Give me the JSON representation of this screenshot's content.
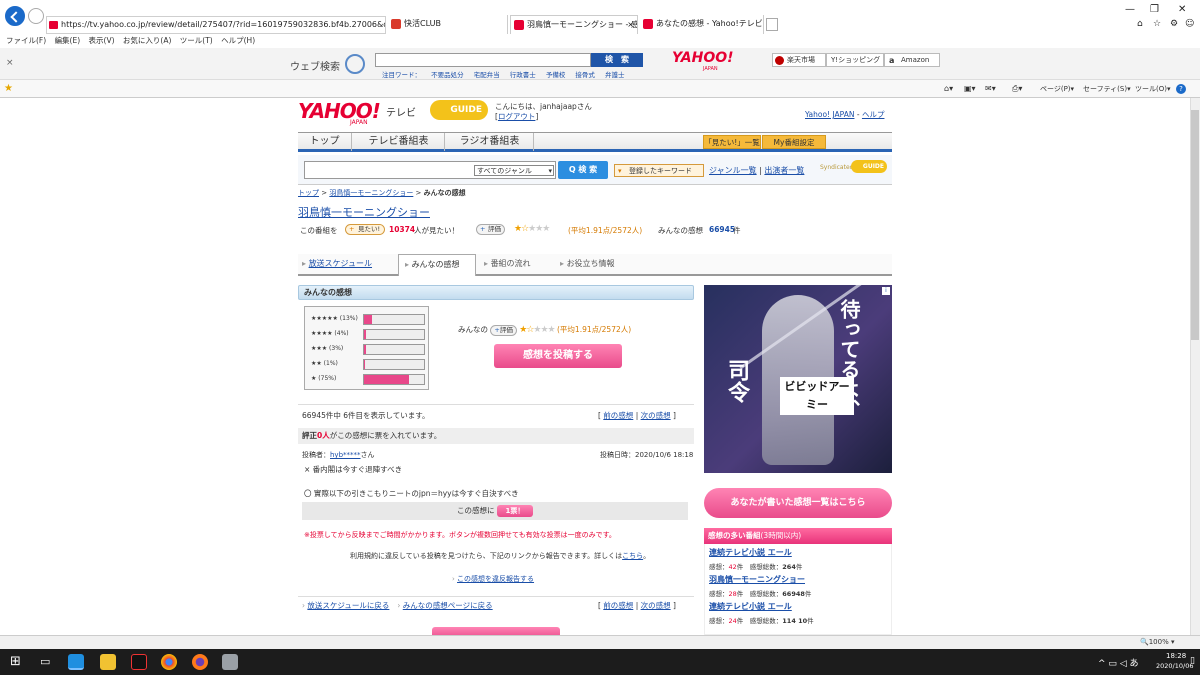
{
  "browser": {
    "url": "https://tv.yahoo.co.jp/review/detail/275407/?rid=16019759032836.bf4b.27006&o=1&",
    "tabs": [
      {
        "title": "快活CLUB",
        "color": "#d93a2b"
      },
      {
        "title": "羽鳥慎一モーニングショー - 感...",
        "color": "#e60033"
      },
      {
        "title": "あなたの感想 - Yahoo!テレビG...",
        "color": "#e60033"
      }
    ],
    "menu": [
      "ファイル(F)",
      "編集(E)",
      "表示(V)",
      "お気に入り(A)",
      "ツール(T)",
      "ヘルプ(H)"
    ],
    "search_label": "ウェブ検索",
    "search_button": "検　索",
    "search_links": [
      "注目ワード：",
      "不要品処分",
      "宅配弁当",
      "行政書士",
      "予備校",
      "接骨式",
      "弁護士"
    ],
    "yahoo_logo": "YAHOO!",
    "yahoo_sub": "JAPAN",
    "shortcuts": [
      "楽天市場",
      "Y!ショッピング",
      "Amazon"
    ],
    "cmd": [
      "ページ(P)",
      "セーフティ(S)",
      "ツール(O)"
    ],
    "zoom": "100%",
    "clock_time": "18:28",
    "clock_date": "2020/10/06"
  },
  "site": {
    "logo": "YAHOO!",
    "logo_sub": "JAPAN",
    "logo_tv": "テレビ",
    "gguide": "GUIDE",
    "greeting": "こんにちは、",
    "username": "janhajaap",
    "san": "さん",
    "logout": "ログアウト",
    "yahoo_japan_link": "Yahoo! JAPAN",
    "help_link": "ヘルプ",
    "nav_tabs": [
      "トップ",
      "テレビ番組表",
      "ラジオ番組表"
    ],
    "mitai_btn": "「見たい!」一覧",
    "my_btn": "My番組設定",
    "genre": "すべてのジャンル",
    "search_btn": "Q 検 索",
    "kw_btn": "登録したキーワード",
    "genre_list": "ジャンル一覧",
    "performer_list": "出演者一覧",
    "sync": "Syndicated"
  },
  "breadcrumb": [
    "トップ",
    "羽鳥慎一モーニングショー",
    "みんなの感想"
  ],
  "program": {
    "title": "羽鳥慎一モーニングショー",
    "mitai_pre": "この番組を",
    "mitai_btn": "見たい!",
    "mitai_count": "10374",
    "mitai_post": "人が見たい！",
    "rate_btn": "評価",
    "avg": "(平均1.91点/2572人)",
    "review_label": "みんなの感想",
    "review_count": "66945",
    "review_unit": "件"
  },
  "subtabs": [
    "放送スケジュール",
    "みんなの感想",
    "番組の流れ",
    "お役立ち情報"
  ],
  "reviews_section": {
    "header": "みんなの感想",
    "dist": [
      {
        "label": "★★★★★ (13%)",
        "pct": 13
      },
      {
        "label": "★★★★ (4%)",
        "pct": 4
      },
      {
        "label": "★★★ (3%)",
        "pct": 3
      },
      {
        "label": "★★ (1%)",
        "pct": 1
      },
      {
        "label": "★ (75%)",
        "pct": 75
      }
    ],
    "minna": "みんなの",
    "avg": "(平均1.91点/2572人)",
    "post_btn": "感想を投稿する",
    "count_text": "66945件中 6件目を表示しています。",
    "prev": "前の感想",
    "next": "次の感想",
    "vote_pre": "評正",
    "vote_n": "0人",
    "vote_post": "がこの感想に票を入れています。",
    "poster_label": "投稿者：",
    "poster_name": "hyb*****",
    "date": "投稿日時：2020/10/6 18:18",
    "line1": "× 番内閣は今すぐ退陣すべき",
    "line2": "〇 實際以下の引きこもりニートのjpn＝hyyは今すぐ自決すべき",
    "vote_box": "この感想に",
    "vote_btn": "1票！",
    "warn": "※投票してから反映までご時間がかかります。ボタンが複数回押せても有効な投票は一度のみです。",
    "terms": "利用規約に違反している投稿を見つけたら、下記のリンクから報告できます。詳しくは",
    "terms_link": "こちら",
    "report": "この感想を違反報告する",
    "back_sched": "放送スケジュールに戻る",
    "back_reviews": "みんなの感想ページに戻る"
  },
  "ad": {
    "line1": "待ってるよ、",
    "line2": "司令",
    "brand": "ビビッドアーミー"
  },
  "side": {
    "my_reviews_btn": "あなたが書いた感想一覧はこちら",
    "ranking_title": "感想の多い番組",
    "ranking_sub": "(3時間以内)",
    "ranking": [
      {
        "title": "連続テレビ小説 エール",
        "a": "感想：",
        "an": "42",
        "b": "件　感想総数：",
        "bn": "264",
        "c": "件"
      },
      {
        "title": "羽鳥慎一モーニングショー",
        "a": "感想：",
        "an": "28",
        "b": "件　感想総数：",
        "bn": "66948",
        "c": "件"
      },
      {
        "title": "連続テレビ小説 エール",
        "a": "感想：",
        "an": "24",
        "b": "件　感想総数：",
        "bn": "114 10",
        "c": "件"
      }
    ]
  }
}
